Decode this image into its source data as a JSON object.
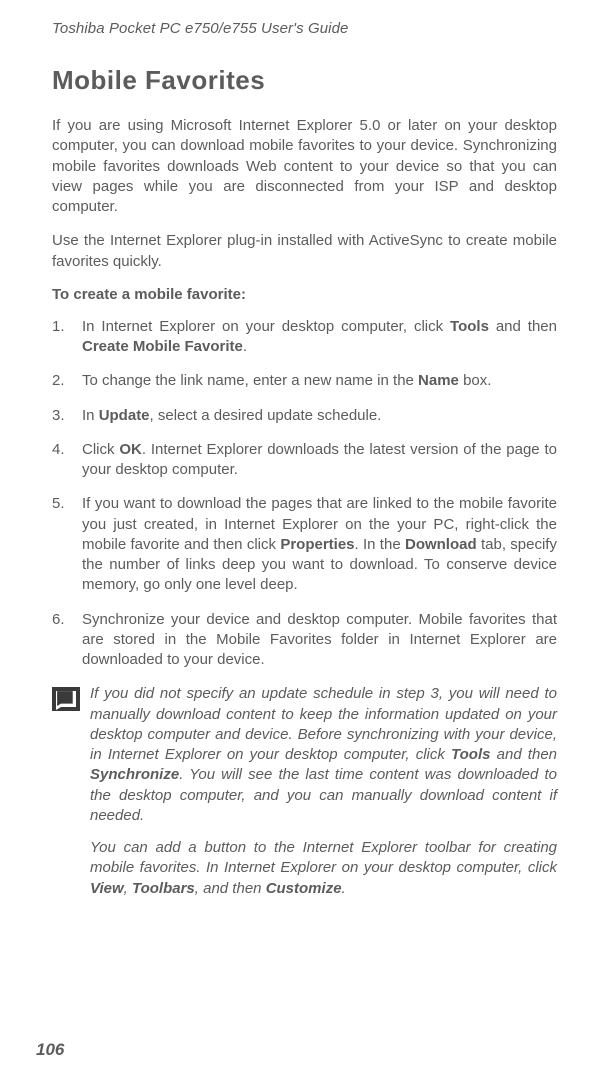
{
  "running_header": "Toshiba Pocket PC e750/e755  User's Guide",
  "section_title": "Mobile Favorites",
  "intro_paras": [
    {
      "segments": [
        {
          "t": "If you are using Microsoft Internet Explorer 5.0 or later on your desktop computer, you can download mobile favorites to your device. Synchronizing mobile favorites downloads Web content to your device so that you can view pages while you are disconnected from your ISP and desktop computer."
        }
      ]
    },
    {
      "segments": [
        {
          "t": "Use the Internet Explorer plug-in installed with ActiveSync to create mobile favorites quickly."
        }
      ]
    }
  ],
  "subhead": "To create a mobile favorite:",
  "steps": [
    {
      "segments": [
        {
          "t": "In Internet Explorer on your desktop computer, click "
        },
        {
          "t": "Tools",
          "b": true
        },
        {
          "t": " and then "
        },
        {
          "t": "Create Mobile Favorite",
          "b": true
        },
        {
          "t": "."
        }
      ]
    },
    {
      "segments": [
        {
          "t": "To change the link name, enter a new name in the "
        },
        {
          "t": "Name",
          "b": true
        },
        {
          "t": " box."
        }
      ]
    },
    {
      "segments": [
        {
          "t": "In  "
        },
        {
          "t": "Update",
          "b": true
        },
        {
          "t": ", select a desired update schedule."
        }
      ]
    },
    {
      "segments": [
        {
          "t": "Click "
        },
        {
          "t": "OK",
          "b": true
        },
        {
          "t": ". Internet Explorer downloads the latest version of the page to your desktop computer."
        }
      ]
    },
    {
      "segments": [
        {
          "t": "If you want to download the pages that are linked to the mobile favorite you just created, in Internet Explorer on the your PC, right-click the mobile favorite and then click  "
        },
        {
          "t": "Properties",
          "b": true
        },
        {
          "t": ". In the "
        },
        {
          "t": "Download",
          "b": true
        },
        {
          "t": "  tab, specify the number of links deep you want to download. To conserve device memory, go only one level deep."
        }
      ]
    },
    {
      "segments": [
        {
          "t": "Synchronize your device and desktop computer. Mobile favorites that are stored in the Mobile Favorites folder in Internet Explorer are downloaded to your device."
        }
      ]
    }
  ],
  "notes": [
    {
      "with_icon": true,
      "segments": [
        {
          "t": "If you did not specify an update schedule in step 3, you will need to manually download content to keep the information updated on your desktop computer and device. Before synchronizing with your device, in Internet Explorer on your desktop computer, click  "
        },
        {
          "t": "Tools",
          "b": true
        },
        {
          "t": " and then  "
        },
        {
          "t": "Synchronize",
          "b": true
        },
        {
          "t": ". You will see the last time content was downloaded to the desktop computer, and you can manually download content if needed."
        }
      ]
    },
    {
      "with_icon": false,
      "segments": [
        {
          "t": "You can add a button to the Internet Explorer toolbar for creating mobile favorites. In Internet Explorer on your desktop computer, click  "
        },
        {
          "t": "View",
          "b": true
        },
        {
          "t": ",  "
        },
        {
          "t": "Toolbars",
          "b": true
        },
        {
          "t": ", and then  "
        },
        {
          "t": "Customize",
          "b": true
        },
        {
          "t": "."
        }
      ]
    }
  ],
  "page_number": "106"
}
